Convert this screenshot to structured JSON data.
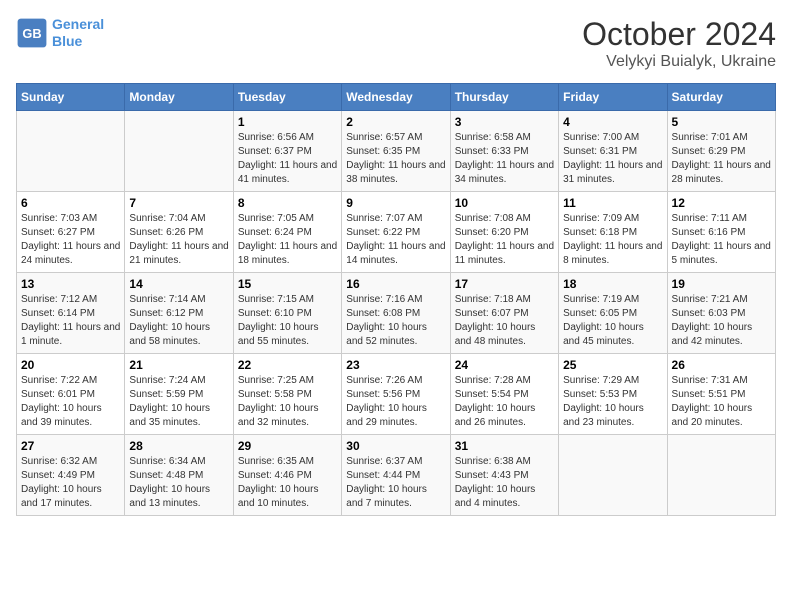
{
  "header": {
    "logo_line1": "General",
    "logo_line2": "Blue",
    "title": "October 2024",
    "subtitle": "Velykyi Buialyk, Ukraine"
  },
  "days_of_week": [
    "Sunday",
    "Monday",
    "Tuesday",
    "Wednesday",
    "Thursday",
    "Friday",
    "Saturday"
  ],
  "weeks": [
    [
      {
        "day": "",
        "info": ""
      },
      {
        "day": "",
        "info": ""
      },
      {
        "day": "1",
        "info": "Sunrise: 6:56 AM\nSunset: 6:37 PM\nDaylight: 11 hours and 41 minutes."
      },
      {
        "day": "2",
        "info": "Sunrise: 6:57 AM\nSunset: 6:35 PM\nDaylight: 11 hours and 38 minutes."
      },
      {
        "day": "3",
        "info": "Sunrise: 6:58 AM\nSunset: 6:33 PM\nDaylight: 11 hours and 34 minutes."
      },
      {
        "day": "4",
        "info": "Sunrise: 7:00 AM\nSunset: 6:31 PM\nDaylight: 11 hours and 31 minutes."
      },
      {
        "day": "5",
        "info": "Sunrise: 7:01 AM\nSunset: 6:29 PM\nDaylight: 11 hours and 28 minutes."
      }
    ],
    [
      {
        "day": "6",
        "info": "Sunrise: 7:03 AM\nSunset: 6:27 PM\nDaylight: 11 hours and 24 minutes."
      },
      {
        "day": "7",
        "info": "Sunrise: 7:04 AM\nSunset: 6:26 PM\nDaylight: 11 hours and 21 minutes."
      },
      {
        "day": "8",
        "info": "Sunrise: 7:05 AM\nSunset: 6:24 PM\nDaylight: 11 hours and 18 minutes."
      },
      {
        "day": "9",
        "info": "Sunrise: 7:07 AM\nSunset: 6:22 PM\nDaylight: 11 hours and 14 minutes."
      },
      {
        "day": "10",
        "info": "Sunrise: 7:08 AM\nSunset: 6:20 PM\nDaylight: 11 hours and 11 minutes."
      },
      {
        "day": "11",
        "info": "Sunrise: 7:09 AM\nSunset: 6:18 PM\nDaylight: 11 hours and 8 minutes."
      },
      {
        "day": "12",
        "info": "Sunrise: 7:11 AM\nSunset: 6:16 PM\nDaylight: 11 hours and 5 minutes."
      }
    ],
    [
      {
        "day": "13",
        "info": "Sunrise: 7:12 AM\nSunset: 6:14 PM\nDaylight: 11 hours and 1 minute."
      },
      {
        "day": "14",
        "info": "Sunrise: 7:14 AM\nSunset: 6:12 PM\nDaylight: 10 hours and 58 minutes."
      },
      {
        "day": "15",
        "info": "Sunrise: 7:15 AM\nSunset: 6:10 PM\nDaylight: 10 hours and 55 minutes."
      },
      {
        "day": "16",
        "info": "Sunrise: 7:16 AM\nSunset: 6:08 PM\nDaylight: 10 hours and 52 minutes."
      },
      {
        "day": "17",
        "info": "Sunrise: 7:18 AM\nSunset: 6:07 PM\nDaylight: 10 hours and 48 minutes."
      },
      {
        "day": "18",
        "info": "Sunrise: 7:19 AM\nSunset: 6:05 PM\nDaylight: 10 hours and 45 minutes."
      },
      {
        "day": "19",
        "info": "Sunrise: 7:21 AM\nSunset: 6:03 PM\nDaylight: 10 hours and 42 minutes."
      }
    ],
    [
      {
        "day": "20",
        "info": "Sunrise: 7:22 AM\nSunset: 6:01 PM\nDaylight: 10 hours and 39 minutes."
      },
      {
        "day": "21",
        "info": "Sunrise: 7:24 AM\nSunset: 5:59 PM\nDaylight: 10 hours and 35 minutes."
      },
      {
        "day": "22",
        "info": "Sunrise: 7:25 AM\nSunset: 5:58 PM\nDaylight: 10 hours and 32 minutes."
      },
      {
        "day": "23",
        "info": "Sunrise: 7:26 AM\nSunset: 5:56 PM\nDaylight: 10 hours and 29 minutes."
      },
      {
        "day": "24",
        "info": "Sunrise: 7:28 AM\nSunset: 5:54 PM\nDaylight: 10 hours and 26 minutes."
      },
      {
        "day": "25",
        "info": "Sunrise: 7:29 AM\nSunset: 5:53 PM\nDaylight: 10 hours and 23 minutes."
      },
      {
        "day": "26",
        "info": "Sunrise: 7:31 AM\nSunset: 5:51 PM\nDaylight: 10 hours and 20 minutes."
      }
    ],
    [
      {
        "day": "27",
        "info": "Sunrise: 6:32 AM\nSunset: 4:49 PM\nDaylight: 10 hours and 17 minutes."
      },
      {
        "day": "28",
        "info": "Sunrise: 6:34 AM\nSunset: 4:48 PM\nDaylight: 10 hours and 13 minutes."
      },
      {
        "day": "29",
        "info": "Sunrise: 6:35 AM\nSunset: 4:46 PM\nDaylight: 10 hours and 10 minutes."
      },
      {
        "day": "30",
        "info": "Sunrise: 6:37 AM\nSunset: 4:44 PM\nDaylight: 10 hours and 7 minutes."
      },
      {
        "day": "31",
        "info": "Sunrise: 6:38 AM\nSunset: 4:43 PM\nDaylight: 10 hours and 4 minutes."
      },
      {
        "day": "",
        "info": ""
      },
      {
        "day": "",
        "info": ""
      }
    ]
  ]
}
